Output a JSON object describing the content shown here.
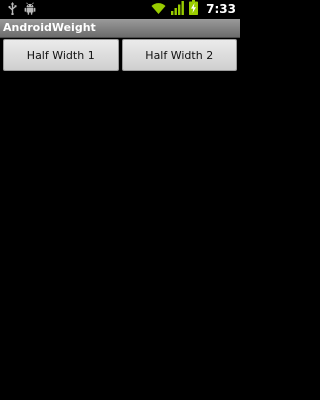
{
  "status_bar": {
    "time": "7:33",
    "icons": [
      "usb-icon",
      "android-icon",
      "wifi-icon",
      "signal-icon",
      "battery-charging-icon"
    ],
    "accent_color": "#99cc00"
  },
  "app": {
    "title": "AndroidWeight"
  },
  "buttons": [
    {
      "label": "Half Width 1"
    },
    {
      "label": "Half Width 2"
    }
  ]
}
